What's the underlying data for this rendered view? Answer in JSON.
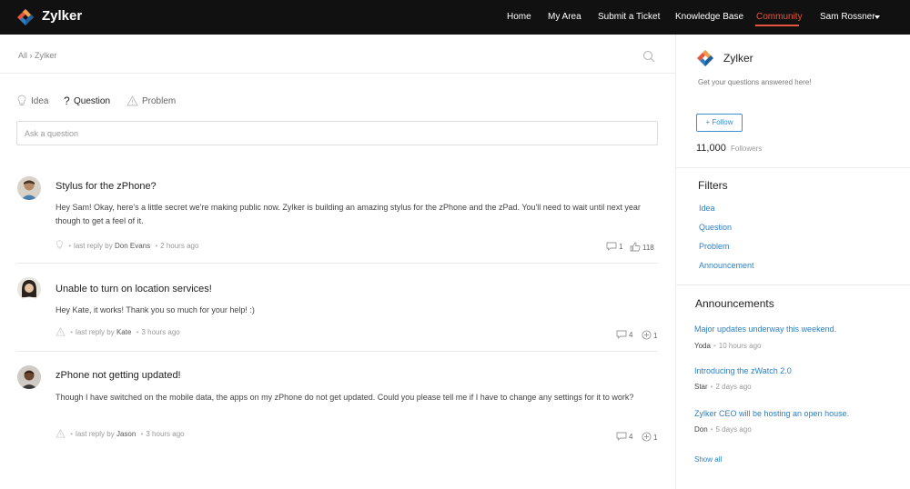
{
  "brand": {
    "name": "Zylker",
    "accent": "#e8553e",
    "link": "#2d7fc4"
  },
  "nav": {
    "items": [
      "Home",
      "My Area",
      "Submit a Ticket",
      "Knowledge Base",
      "Community"
    ],
    "active": "Community",
    "user": "Sam Rossner"
  },
  "breadcrumb": "All › Zylker",
  "tabs": {
    "idea": "Idea",
    "question": "Question",
    "problem": "Problem",
    "active": "Question"
  },
  "ask": {
    "placeholder": "Ask a question"
  },
  "posts": [
    {
      "title": "Stylus for the zPhone?",
      "body": "Hey Sam! Okay, here's a little secret we're making public now. Zylker is building an amazing stylus for the zPhone and the zPad. You'll need to wait until next year though to get a feel of it.",
      "type_icon": "lightbulb-icon",
      "last_reply_label": "last reply by",
      "author": "Don Evans",
      "time": "2 hours ago",
      "comments": "1",
      "votes": "118",
      "vote_icon": "thumbs-up-icon"
    },
    {
      "title": "Unable to turn on location services!",
      "body": "Hey Kate, it works! Thank you so much for your help! :)",
      "type_icon": "warning-icon",
      "last_reply_label": "last reply by",
      "author": "Kate",
      "time": "3 hours ago",
      "comments": "4",
      "votes": "1",
      "vote_icon": "plus-one-icon"
    },
    {
      "title": "zPhone not getting updated!",
      "body": "Though I have switched on the mobile data, the apps on my zPhone do not get updated. Could you please tell me if I have to change any settings for it to work?",
      "type_icon": "warning-icon",
      "last_reply_label": "last reply by",
      "author": "Jason",
      "time": "3 hours ago",
      "comments": "4",
      "votes": "1",
      "vote_icon": "plus-one-icon"
    }
  ],
  "sidebar": {
    "name": "Zylker",
    "tagline": "Get your questions answered here!",
    "follow_label": "+ Follow",
    "followers_count": "11,000",
    "followers_label": "Followers",
    "filters_title": "Filters",
    "filters": [
      "Idea",
      "Question",
      "Problem",
      "Announcement"
    ],
    "announcements_title": "Announcements",
    "announcements": [
      {
        "title": "Major updates underway this weekend.",
        "author": "Yoda",
        "time": "10 hours ago"
      },
      {
        "title": "Introducing the zWatch 2.0",
        "author": "Star",
        "time": "2 days ago"
      },
      {
        "title": "Zylker CEO will be hosting an open house.",
        "author": "Don",
        "time": "5 days ago"
      }
    ],
    "show_all": "Show all"
  }
}
